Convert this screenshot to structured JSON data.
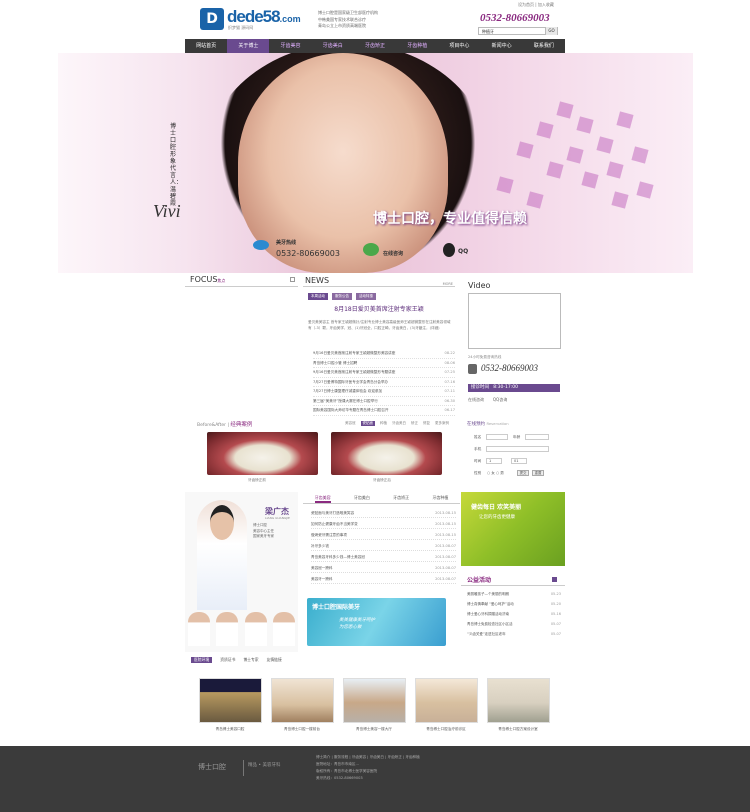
{
  "header": {
    "logo_text": "dede58",
    "logo_suffix": ".com",
    "logo_sub": "织梦猫 源码网",
    "slogans": [
      "博士口腔是国家级卫生部医疗机构",
      "中韩美国专家技术联合诊疗",
      "青岛公立上市资质高端医院"
    ],
    "top_links": [
      "设为首页",
      "加入收藏"
    ],
    "hotline": "0532-80669003",
    "search_value": "种植牙",
    "search_button": "GO"
  },
  "nav": {
    "items": [
      "网站首页",
      "关于博士",
      "牙齿美容",
      "牙齿美白",
      "牙齿矫正",
      "牙齿种植",
      "项目中心",
      "新闻中心",
      "联系我们"
    ]
  },
  "banner": {
    "vertical_text": "博士口腔形象代言人：温碧霞",
    "signature": "Vivi",
    "slogan": "博士口腔，专业值得信赖",
    "hotline_label": "美牙热线",
    "hotline_number": "0532-80669003",
    "online_label": "在线咨询",
    "qq_label": "QQ"
  },
  "focus": {
    "title": "FOCUS",
    "title_cn": "焦点"
  },
  "news": {
    "title": "NEWS",
    "more": "MORE",
    "tabs": [
      "本周活动",
      "服务公告",
      "活动特惠"
    ],
    "headline": "8月18日爱贝美首席注射专家王颖",
    "summary": "    爱贝美美容主 首专家王颖超微针/注射专业博士美容高级医师王颖超微整形在注射美容领域有（-3）颗，牙齿美学，冠、(1)牙冠全，口腔正畸，牙齿美白，(3)牙龈注，(详细)",
    "items": [
      {
        "title": "9月16日爱贝美首席注射专家王颖超微整形美容讲座",
        "date": "08-22"
      },
      {
        "title": "青岛博士口腔小管 博士招聘",
        "date": "08-06"
      },
      {
        "title": "9月16日爱贝美首席注射专家王颖超微整形专题讲座",
        "date": "07-25"
      },
      {
        "title": "7月27日爱博特国际牙医专业学会青岛分会举办",
        "date": "07-16"
      },
      {
        "title": "7月27日博士康复理疗减重体验会 欢迎参加",
        "date": "07-11"
      },
      {
        "title": "第三届“美美牙”授课大赛在博士口腔举行",
        "date": "06-30"
      },
      {
        "title": "国际美容国际大师访华专题在青岛博士口腔召开",
        "date": "06-17"
      }
    ]
  },
  "video": {
    "title": "Video",
    "consult_text": "24小时免费咨询热线",
    "phone": "0532-80669003",
    "hours_label": "接诊时间",
    "hours": "8:30-17:00",
    "online": "在线咨询",
    "qq": "QQ咨询"
  },
  "cases": {
    "title_en": "Before&After",
    "title_cn": "经典案例",
    "tabs": [
      "美容冠",
      "瓷贴面",
      "种植",
      "牙齿美白",
      "矫正",
      "修复",
      "更多案例"
    ],
    "captions": [
      "牙齿矫正前",
      "牙齿矫正后"
    ]
  },
  "reservation": {
    "title": "在线预约",
    "title_en": "Reservation",
    "name_label": "姓名",
    "age_label": "年龄",
    "phone_label": "手机",
    "time_label": "时间",
    "month": "1",
    "day": "01",
    "sex_label": "性别",
    "male": "女",
    "female": "男",
    "submit": "提交",
    "reset": "重置"
  },
  "doctor": {
    "name": "梁广杰",
    "name_en": "LIANG GUANGJIE",
    "roles": [
      "博士口腔",
      "美容中心主任",
      "国家美牙专家"
    ]
  },
  "services": {
    "tabs": [
      "牙齿美容",
      "牙齿美白",
      "牙齿矫正",
      "牙齿种植"
    ],
    "items": [
      {
        "title": "瓷贴面与美牙打造唯美笑容",
        "date": "2013-08-15"
      },
      {
        "title": "如何防止健康牙齿不当美学变",
        "date": "2013-08-15"
      },
      {
        "title": "做烤瓷牙需注意的事项",
        "date": "2013-08-15"
      },
      {
        "title": "补牙多少钱",
        "date": "2013-08-07"
      },
      {
        "title": "青岛美容牙科多少钱—博士美容冠",
        "date": "2013-08-07"
      },
      {
        "title": "美容冠一跨科",
        "date": "2013-08-07"
      },
      {
        "title": "美容牙一跨科",
        "date": "2013-08-07"
      }
    ]
  },
  "ad": {
    "title": "博士口腔国际美牙",
    "line1": "美美健康美牙呵护",
    "line2": "为您悉心做"
  },
  "green_ad": {
    "title": "健齿每日 欢笑美丽",
    "line": "让您的牙齿更健康"
  },
  "public": {
    "title": "公益活动",
    "items": [
      {
        "title": "美丽暖孩子—个美丽的明朗",
        "date": "05-23"
      },
      {
        "title": "博士真情奉献 “爱心呵护”活动",
        "date": "05-20"
      },
      {
        "title": "博士爱心牙科捐赠活动济南",
        "date": "05-16"
      },
      {
        "title": "青岛博士免费检查社区小区活",
        "date": "05-07"
      },
      {
        "title": "“义齿关爱”走进社区老年",
        "date": "05-07"
      }
    ]
  },
  "environment": {
    "tabs": [
      "医院环境",
      "资质证书",
      "博士专家",
      "友情链接"
    ],
    "captions": [
      "青岛博士美容口腔",
      "青岛博士口腔一楼前台",
      "青岛博士美容一楼大厅",
      "青岛博士口腔治疗前诊区",
      "青岛博士口腔方案设计室"
    ]
  },
  "footer": {
    "logo": "博士口腔",
    "logo_sub": "精品 • 美容牙科",
    "links": "博士简介 | 服务流程 | 牙齿美容 | 牙齿美白 | 牙齿矫正 | 牙齿种植",
    "address": "医院地址：青岛市市南区...",
    "copyright": "版权所有：青岛市北博士医学美容医院",
    "hotline": "美牙热线：0532-80669003"
  },
  "colors": {
    "accent": "#6a4a8f",
    "nav_bg": "#393939",
    "footer_bg": "#3b3b3b"
  }
}
